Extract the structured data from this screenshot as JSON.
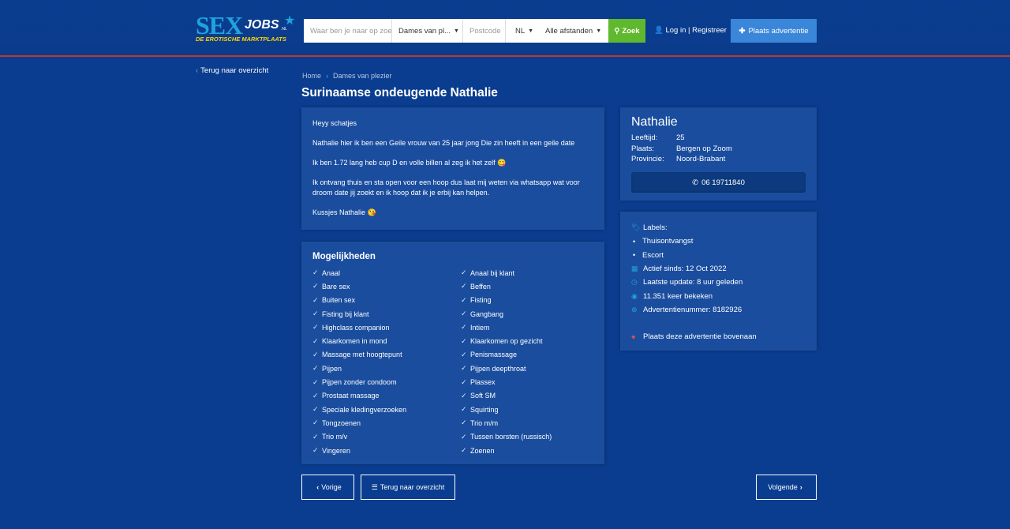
{
  "logo": {
    "sex": "SEX",
    "jobs": "JOBS",
    "nl": ".NL",
    "tagline": "DE EROTISCHE MARKTPLAATS"
  },
  "search": {
    "query_placeholder": "Waar ben je naar op zoek",
    "category_value": "Dames van pl...",
    "postcode_placeholder": "Postcode",
    "country_value": "NL",
    "distance_value": "Alle afstanden",
    "button_label": "Zoek"
  },
  "header": {
    "login_label": "Log in | Registreer",
    "place_ad_label": "Plaats advertentie"
  },
  "back_link": "Terug naar overzicht",
  "breadcrumb": {
    "home": "Home",
    "category": "Dames van plezier"
  },
  "title": "Surinaamse ondeugende Nathalie",
  "description": [
    "Heyy schatjes",
    "Nathalie hier ik ben een Geile vrouw van 25 jaar jong Die zin heeft in een geile date",
    "Ik ben 1.72 lang heb cup D en volle billen al zeg ik het zelf 😋",
    "Ik ontvang thuis en sta open voor een hoop dus laat mij weten via whatsapp wat voor droom date jij zoekt en ik hoop dat ik je erbij kan helpen.",
    "Kussjes Nathalie 😘"
  ],
  "mogelijkheden": {
    "heading": "Mogelijkheden",
    "items": [
      "Anaal",
      "Anaal bij klant",
      "Bare sex",
      "Beffen",
      "Buiten sex",
      "Fisting",
      "Fisting bij klant",
      "Gangbang",
      "Highclass companion",
      "Intiem",
      "Klaarkomen in mond",
      "Klaarkomen op gezicht",
      "Massage met hoogtepunt",
      "Penismassage",
      "Pijpen",
      "Pijpen deepthroat",
      "Pijpen zonder condoom",
      "Plassex",
      "Prostaat massage",
      "Soft SM",
      "Speciale kledingverzoeken",
      "Squirting",
      "Tongzoenen",
      "Trio m/m",
      "Trio m/v",
      "Tussen borsten (russisch)",
      "Vingeren",
      "Zoenen"
    ]
  },
  "profile": {
    "name": "Nathalie",
    "age_label": "Leeftijd:",
    "age": "25",
    "city_label": "Plaats:",
    "city": "Bergen op Zoom",
    "province_label": "Provincie:",
    "province": "Noord-Brabant",
    "phone": "06 19711840"
  },
  "info": {
    "labels_label": "Labels:",
    "labels": [
      "Thuisontvangst",
      "Escort"
    ],
    "active_since": "Actief sinds: 12 Oct 2022",
    "last_update": "Laatste update: 8 uur geleden",
    "views": "11.351 keer bekeken",
    "ad_number": "Advertentienummer: 8182926",
    "promote": "Plaats deze advertentie bovenaan"
  },
  "pager": {
    "prev": "Vorige",
    "overview": "Terug naar overzicht",
    "next": "Volgende"
  },
  "colors": {
    "background": "#0a3d8f",
    "panel": "#1a4d9e",
    "accent": "#1fa3e0",
    "search_button": "#5fb82d",
    "cta": "#3a86d9",
    "heart": "#e0504d"
  }
}
